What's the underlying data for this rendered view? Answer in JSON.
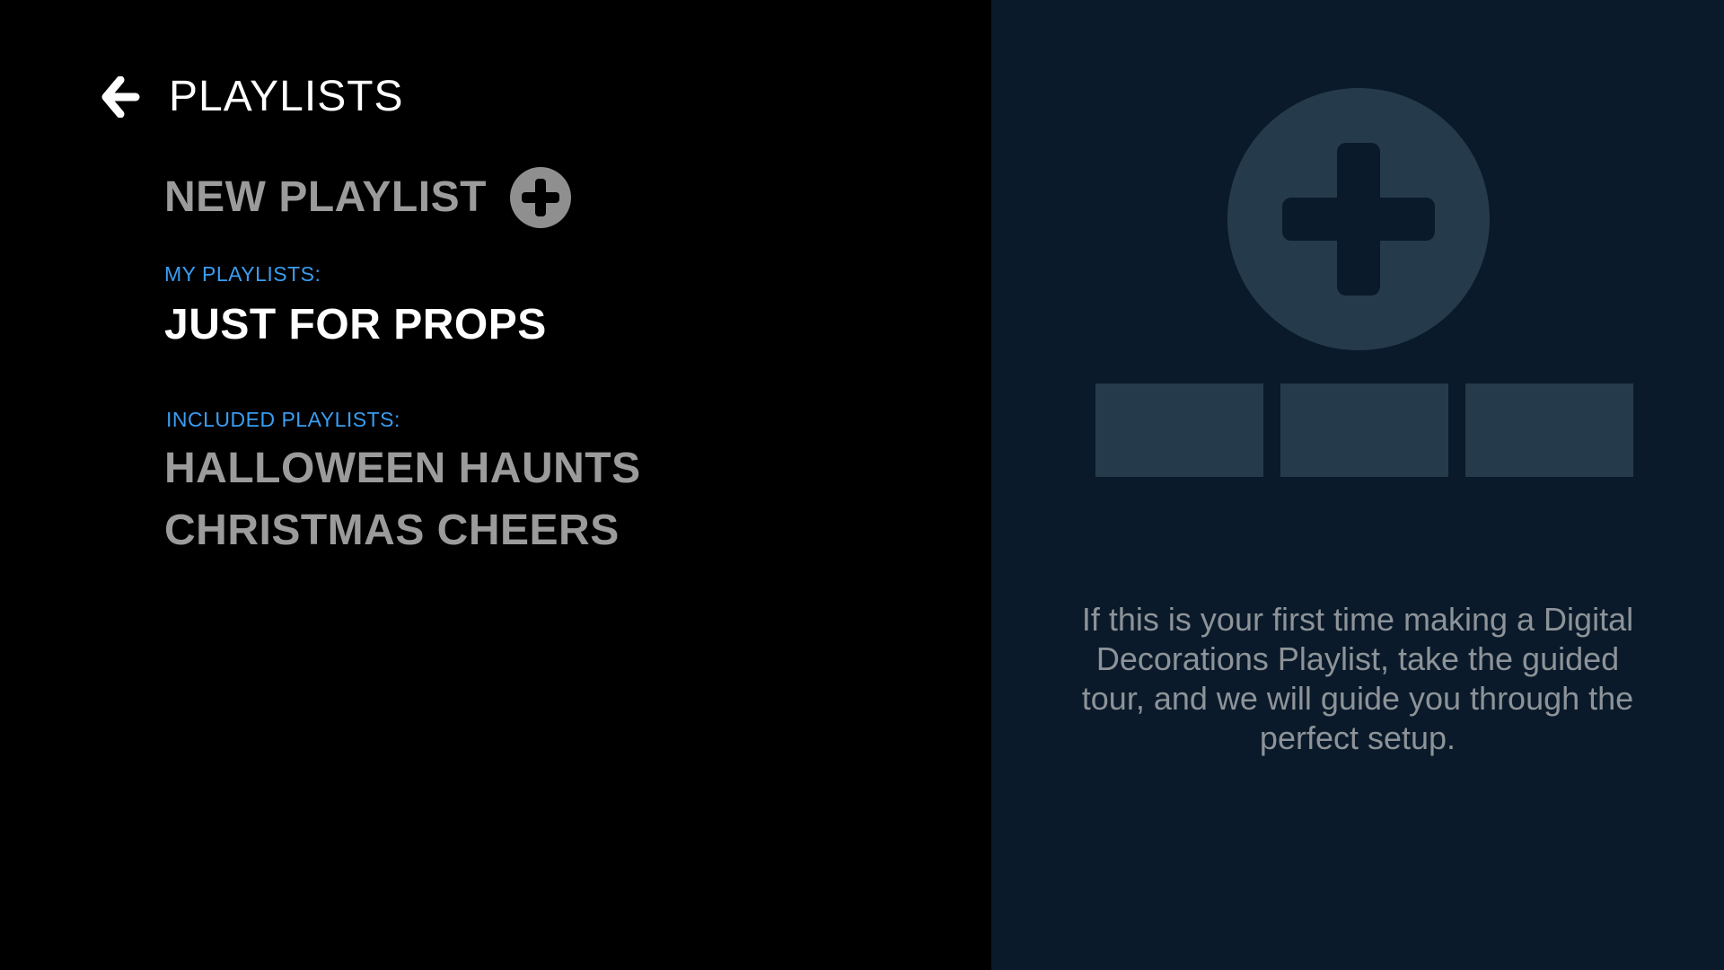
{
  "header": {
    "back_icon": "arrow-left-icon",
    "title": "PLAYLISTS"
  },
  "new_playlist": {
    "label": "NEW PLAYLIST",
    "icon": "plus-circle-icon"
  },
  "my_playlists": {
    "label": "MY PLAYLISTS:",
    "items": [
      {
        "label": "JUST FOR PROPS"
      }
    ]
  },
  "included_playlists": {
    "label": "INCLUDED PLAYLISTS:",
    "items": [
      {
        "label": "HALLOWEEN HAUNTS"
      },
      {
        "label": "CHRISTMAS CHEERS"
      }
    ]
  },
  "tour_panel": {
    "icon": "plus-circle-icon",
    "placeholder_tiles": 3,
    "message": "If this is your first time making a Digital Decorations Playlist, take the guided tour, and we will guide you through the perfect setup."
  },
  "colors": {
    "background_left": "#000000",
    "background_right": "#0a1a2a",
    "section_label": "#3a9df2",
    "active_item": "#ffffff",
    "inactive_item": "#9b9b9b",
    "placeholder": "#253a4b"
  }
}
